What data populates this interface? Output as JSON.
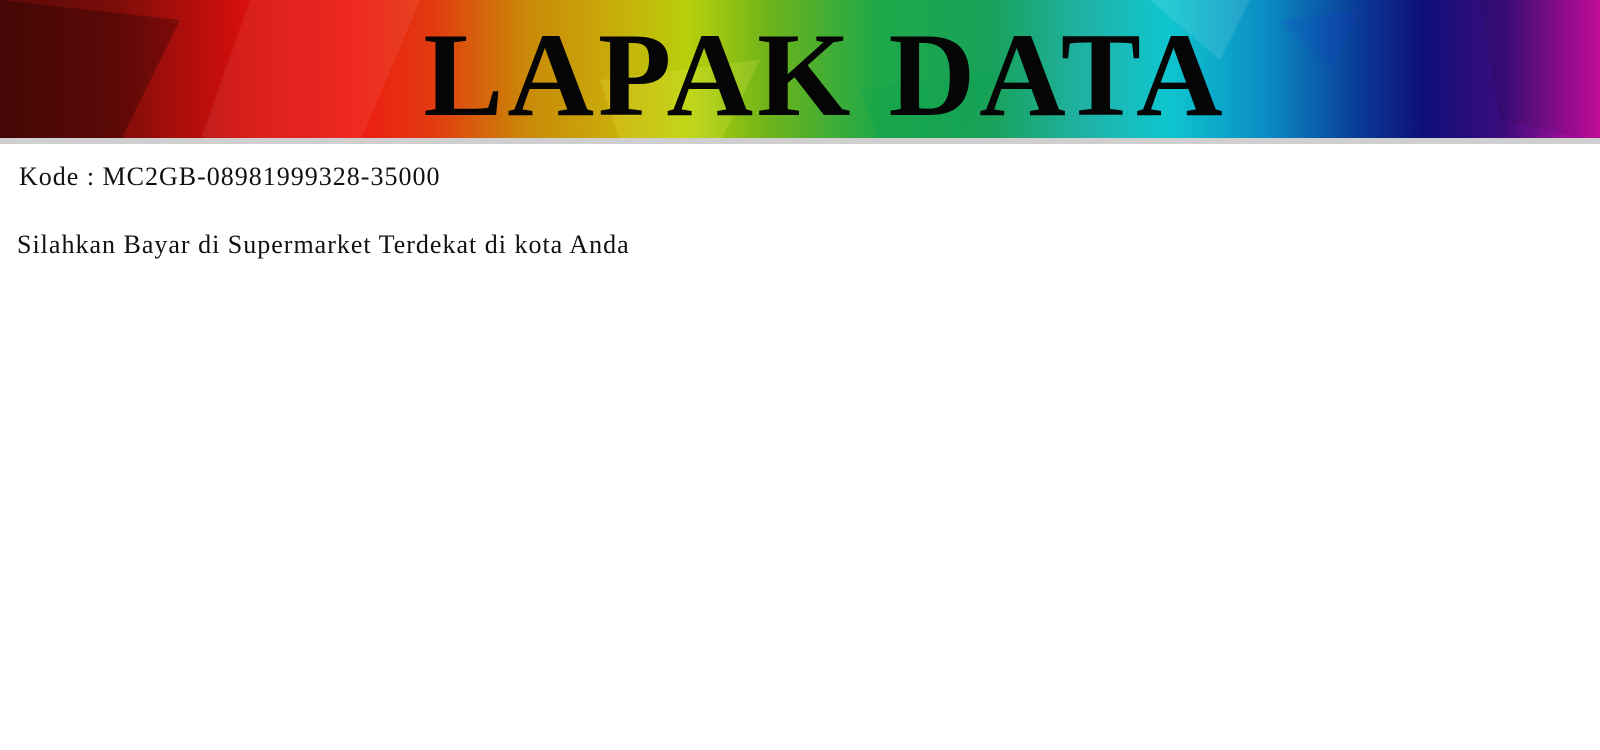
{
  "header": {
    "title": "LAPAK DATA",
    "colors": [
      "#5a0a08",
      "#ee1a12",
      "#c9aa0a",
      "#1da84a",
      "#0fc6cf",
      "#0e0f78",
      "#d00fa5"
    ]
  },
  "content": {
    "kode_label": "Kode :",
    "kode_value": "MC2GB-08981999328-35000",
    "payment_instruction": "Silahkan Bayar di Supermarket Terdekat di kota Anda"
  }
}
